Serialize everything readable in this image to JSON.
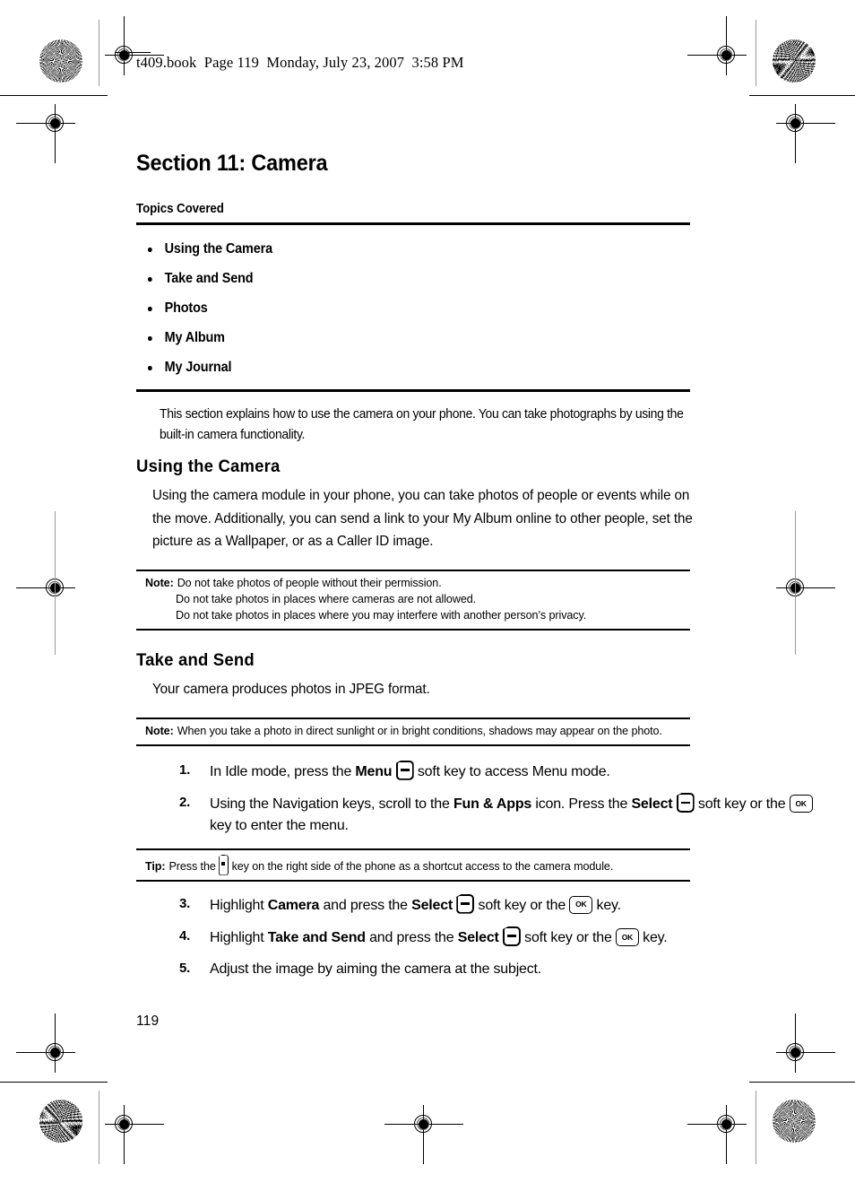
{
  "printer_header": "t409.book  Page 119  Monday, July 23, 2007  3:58 PM",
  "page_number": "119",
  "section": {
    "title": "Section 11: Camera",
    "topics_heading": "Topics Covered",
    "topics": [
      "Using the Camera",
      "Take and Send",
      "Photos",
      "My Album",
      "My Journal"
    ],
    "intro": "This section explains how to use the camera on your phone. You can take photographs by using the built-in camera functionality."
  },
  "using_the_camera": {
    "heading": "Using the Camera",
    "body": "Using the camera module in your phone, you can take photos of people or events while on the move. Additionally, you can send a link to your My Album online to other people, set the picture as a Wallpaper, or as a Caller ID image.",
    "note": {
      "label": "Note:",
      "lines": [
        "Do not take photos of people without their permission.",
        "Do not take photos in places where cameras are not allowed.",
        "Do not take photos in places where you may interfere with another person’s privacy."
      ]
    }
  },
  "take_and_send": {
    "heading": "Take and Send",
    "body": "Your camera produces photos in JPEG format.",
    "note": {
      "label": "Note:",
      "lines": [
        "When you take a photo in direct sunlight or in bright conditions, shadows may appear on the photo."
      ]
    },
    "tip": {
      "label": "Tip:",
      "before_key": "Press the",
      "after_key": "key on the right side of the phone as a shortcut access to the camera module."
    },
    "steps_part1": [
      {
        "num": "1.",
        "parts": [
          {
            "t": "text",
            "v": "In Idle mode, press the "
          },
          {
            "t": "bold",
            "v": "Menu"
          },
          {
            "t": "text",
            "v": " "
          },
          {
            "t": "key",
            "v": "soft-key"
          },
          {
            "t": "text",
            "v": " soft key to access Menu mode."
          }
        ]
      },
      {
        "num": "2.",
        "parts": [
          {
            "t": "text",
            "v": "Using the Navigation keys, scroll to the "
          },
          {
            "t": "bold",
            "v": "Fun & Apps"
          },
          {
            "t": "text",
            "v": " icon. Press the "
          },
          {
            "t": "bold",
            "v": "Select"
          },
          {
            "t": "text",
            "v": " "
          },
          {
            "t": "key",
            "v": "soft-key"
          },
          {
            "t": "text",
            "v": " soft key or the "
          },
          {
            "t": "key",
            "v": "ok-key"
          },
          {
            "t": "text",
            "v": " key to enter the menu."
          }
        ]
      }
    ],
    "steps_part2": [
      {
        "num": "3.",
        "parts": [
          {
            "t": "text",
            "v": "Highlight "
          },
          {
            "t": "bold",
            "v": "Camera"
          },
          {
            "t": "text",
            "v": " and press the "
          },
          {
            "t": "bold",
            "v": "Select"
          },
          {
            "t": "text",
            "v": " "
          },
          {
            "t": "key",
            "v": "soft-key"
          },
          {
            "t": "text",
            "v": " soft key or the "
          },
          {
            "t": "key",
            "v": "ok-key"
          },
          {
            "t": "text",
            "v": " key."
          }
        ]
      },
      {
        "num": "4.",
        "parts": [
          {
            "t": "text",
            "v": "Highlight "
          },
          {
            "t": "bold",
            "v": "Take and Send"
          },
          {
            "t": "text",
            "v": " and press the "
          },
          {
            "t": "bold",
            "v": "Select"
          },
          {
            "t": "text",
            "v": " "
          },
          {
            "t": "key",
            "v": "soft-key"
          },
          {
            "t": "text",
            "v": " soft key or the "
          },
          {
            "t": "key",
            "v": "ok-key"
          },
          {
            "t": "text",
            "v": " key."
          }
        ]
      },
      {
        "num": "5.",
        "parts": [
          {
            "t": "text",
            "v": "Adjust the image by aiming the camera at the subject."
          }
        ]
      }
    ]
  },
  "keys": {
    "ok_label": "OK"
  }
}
